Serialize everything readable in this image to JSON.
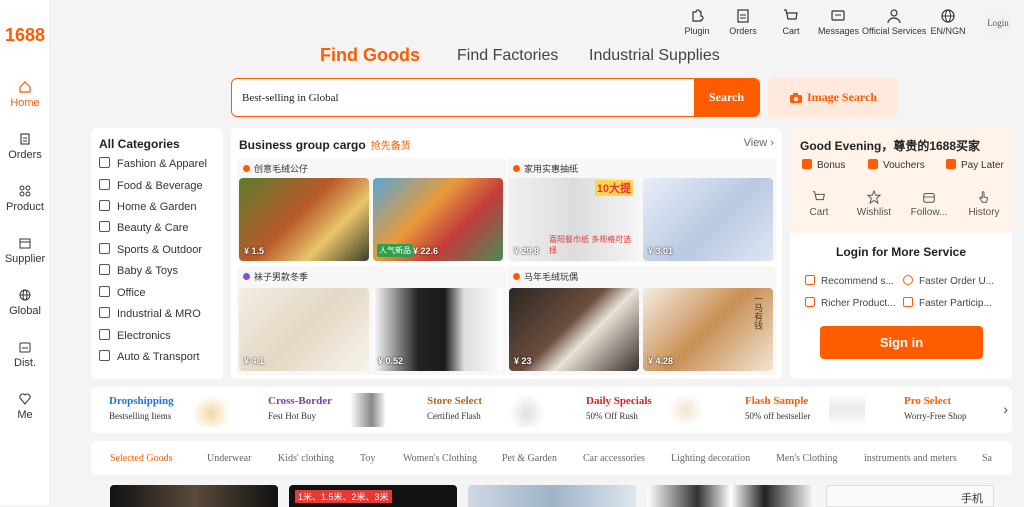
{
  "logo": "1688",
  "sidebar": {
    "items": [
      {
        "label": "Home",
        "icon": "home-icon",
        "active": true
      },
      {
        "label": "Orders",
        "icon": "orders-icon"
      },
      {
        "label": "Product",
        "icon": "grid-icon"
      },
      {
        "label": "Supplier",
        "icon": "supplier-icon"
      },
      {
        "label": "Global",
        "icon": "globe-icon"
      },
      {
        "label": "Dist.",
        "icon": "dist-icon"
      },
      {
        "label": "Me",
        "icon": "me-icon"
      }
    ]
  },
  "topbar": {
    "items": [
      {
        "label": "Plugin",
        "icon": "plugin-icon"
      },
      {
        "label": "Orders",
        "icon": "clipboard-icon"
      },
      {
        "label": "Cart",
        "icon": "cart-icon"
      },
      {
        "label": "Messages",
        "icon": "message-icon"
      },
      {
        "label": "Official Services",
        "icon": "user-icon"
      },
      {
        "label": "EN/NGN",
        "icon": "globe-icon"
      }
    ],
    "login": "Login"
  },
  "tabs": [
    "Find Goods",
    "Find Factories",
    "Industrial Supplies"
  ],
  "search": {
    "value": "Best-selling in Global",
    "button": "Search",
    "image_search": "Image Search"
  },
  "categories": {
    "title": "All Categories",
    "items": [
      "Fashion & Apparel",
      "Food & Beverage",
      "Home & Garden",
      "Beauty & Care",
      "Sports & Outdoor",
      "Baby & Toys",
      "Office",
      "Industrial & MRO",
      "Electronics",
      "Auto & Transport"
    ]
  },
  "business": {
    "title": "Business group cargo",
    "tag": "抢先备货",
    "view": "View",
    "groups": [
      {
        "label": "创意毛绒公仔",
        "products": [
          {
            "price": "¥ 1.5"
          },
          {
            "price": "¥ 22.6",
            "badge": "人气新品"
          }
        ]
      },
      {
        "label": "家用实惠抽纸",
        "products": [
          {
            "price": "¥ 29.8",
            "badge": "喜阳餐巾纸 多规格可选择",
            "tag": "10大提"
          },
          {
            "price": "¥ 3.01"
          }
        ]
      },
      {
        "label": "袜子男款冬季",
        "products": [
          {
            "price": "¥ 4.1"
          },
          {
            "price": "¥ 0.52"
          }
        ]
      },
      {
        "label": "马年毛绒玩偶",
        "products": [
          {
            "price": "¥ 23"
          },
          {
            "price": "¥ 4.28",
            "tag": "一马有钱"
          }
        ]
      }
    ]
  },
  "account": {
    "greeting": "Good Evening，尊贵的1688买家",
    "perks": [
      "Bonus",
      "Vouchers",
      "Pay Later"
    ],
    "quick": [
      "Cart",
      "Wishlist",
      "Follow...",
      "History"
    ],
    "login_title": "Login for More Service",
    "services": [
      "Recommend s...",
      "Faster Order U...",
      "Richer Product...",
      "Faster Particip..."
    ],
    "signin": "Sign in"
  },
  "promos": [
    {
      "title": "Dropshipping",
      "sub": "Bestselling Items",
      "color": "#1a73e8"
    },
    {
      "title": "Cross-Border",
      "sub": "Fest Hot Buy",
      "color": "#7b3fa0"
    },
    {
      "title": "Store Select",
      "sub": "Certified Flash",
      "color": "#b5651d"
    },
    {
      "title": "Daily Specials",
      "sub": "50% Off Rush",
      "color": "#e0201c"
    },
    {
      "title": "Flash Sample",
      "sub": "50% off bestseller",
      "color": "#ff5b00"
    },
    {
      "title": "Pro Select",
      "sub": "Worry-Free Shop",
      "color": "#ff5b00"
    }
  ],
  "chips": [
    "Selected Goods",
    "Underwear",
    "Kids' clothing",
    "Toy",
    "Women's Clothing",
    "Pet & Garden",
    "Car accessories",
    "Lighting decoration",
    "Men's Clothing",
    "instruments and meters",
    "Sa"
  ],
  "thumbs": [
    {
      "text": ""
    },
    {
      "text": "1米、1.5米、2米、3米"
    },
    {
      "text": ""
    },
    {
      "text": ""
    },
    {
      "text": "手机"
    }
  ],
  "colors": {
    "accent": "#ff5b00",
    "accent_light": "#ffe9dc"
  }
}
